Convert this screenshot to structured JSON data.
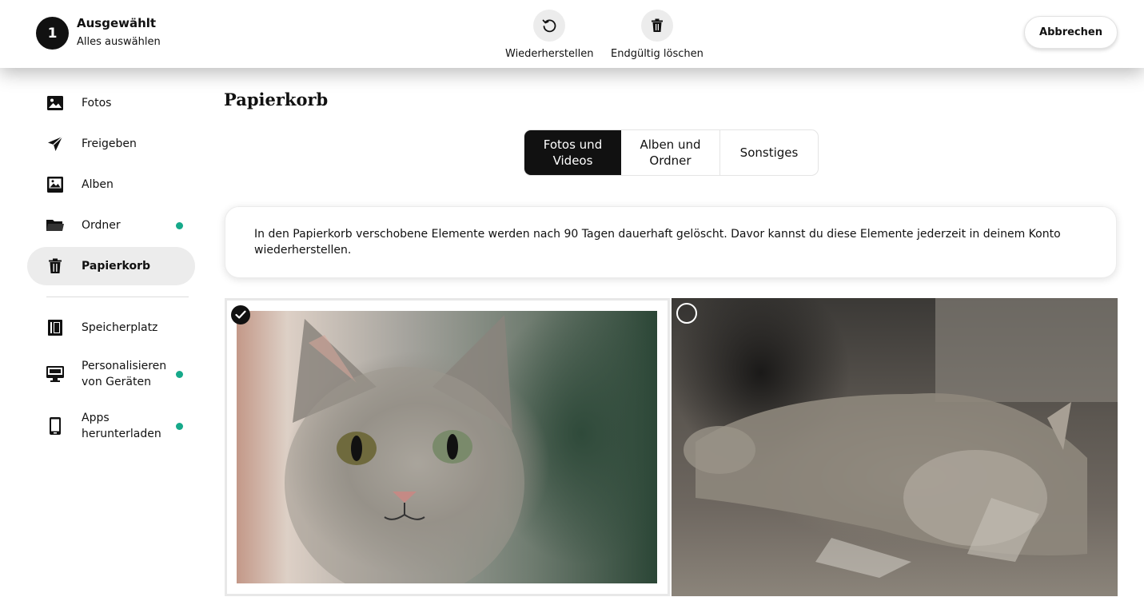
{
  "selection": {
    "count": "1",
    "title": "Ausgewählt",
    "select_all": "Alles auswählen"
  },
  "actions": {
    "restore_label": "Wiederherstellen",
    "restore_icon": "restore-icon",
    "delete_label": "Endgültig löschen",
    "delete_icon": "trash-icon",
    "cancel_label": "Abbrechen"
  },
  "sidebar": {
    "items": [
      {
        "label": "Fotos",
        "icon": "photo-icon",
        "dot": false,
        "active": false
      },
      {
        "label": "Freigeben",
        "icon": "send-icon",
        "dot": false,
        "active": false
      },
      {
        "label": "Alben",
        "icon": "album-icon",
        "dot": false,
        "active": false
      },
      {
        "label": "Ordner",
        "icon": "folder-icon",
        "dot": true,
        "active": false
      },
      {
        "label": "Papierkorb",
        "icon": "trash-icon",
        "dot": false,
        "active": true
      },
      {
        "label": "Speicherplatz",
        "icon": "storage-icon",
        "dot": false,
        "active": false
      },
      {
        "label": "Personalisieren von Geräten",
        "icon": "device-icon",
        "dot": true,
        "active": false
      },
      {
        "label": "Apps herunterladen",
        "icon": "phone-icon",
        "dot": true,
        "active": false
      }
    ]
  },
  "main": {
    "title": "Papierkorb",
    "tabs": [
      {
        "label": "Fotos und Videos",
        "selected": true
      },
      {
        "label": "Alben und Ordner",
        "selected": false
      },
      {
        "label": "Sonstiges",
        "selected": false
      }
    ],
    "notice": "In den Papierkorb verschobene Elemente werden nach 90 Tagen dauerhaft gelöscht. Davor kannst du diese Elemente jederzeit in deinem Konto wiederherstellen.",
    "photos": [
      {
        "subject": "cat portrait",
        "selected": true
      },
      {
        "subject": "cat lying on floor",
        "selected": false
      }
    ]
  },
  "colors": {
    "accent_dot": "#16a98a",
    "selected_tab": "#111111"
  }
}
